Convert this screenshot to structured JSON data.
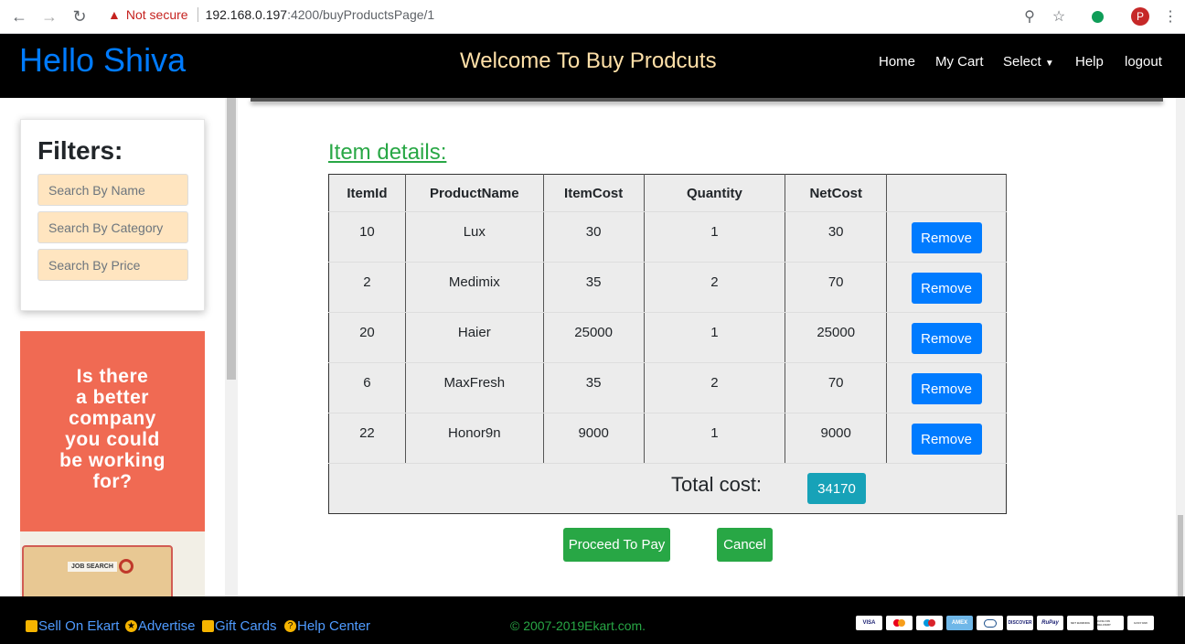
{
  "browser": {
    "security_label": "Not secure",
    "url_host": "192.168.0.197",
    "url_path": ":4200/buyProductsPage/1",
    "profile_initial": "P"
  },
  "header": {
    "greeting": "Hello Shiva",
    "title": "Welcome To Buy Prodcuts",
    "nav": {
      "home": "Home",
      "cart": "My Cart",
      "select": "Select",
      "help": "Help",
      "logout": "logout"
    }
  },
  "sidebar": {
    "filters_title": "Filters:",
    "search_name_placeholder": "Search By Name",
    "search_category_placeholder": "Search By Category",
    "search_price_placeholder": "Search By Price",
    "ad_text": "Is there\na better\ncompany\nyou could\nbe working\nfor?",
    "ad_image_label": "JOB SEARCH"
  },
  "main": {
    "section_title": "Item details:",
    "columns": [
      "ItemId",
      "ProductName",
      "ItemCost",
      "Quantity",
      "NetCost",
      ""
    ],
    "rows": [
      {
        "id": "10",
        "name": "Lux",
        "cost": "30",
        "qty": "1",
        "net": "30"
      },
      {
        "id": "2",
        "name": "Medimix",
        "cost": "35",
        "qty": "2",
        "net": "70"
      },
      {
        "id": "20",
        "name": "Haier",
        "cost": "25000",
        "qty": "1",
        "net": "25000"
      },
      {
        "id": "6",
        "name": "MaxFresh",
        "cost": "35",
        "qty": "2",
        "net": "70"
      },
      {
        "id": "22",
        "name": "Honor9n",
        "cost": "9000",
        "qty": "1",
        "net": "9000"
      }
    ],
    "remove_label": "Remove",
    "total_label": "Total cost:",
    "total_value": "34170",
    "proceed_label": "Proceed To Pay",
    "cancel_label": "Cancel"
  },
  "footer": {
    "sell": "Sell On Ekart",
    "advertise": "Advertise",
    "gift": "Gift Cards",
    "help": "Help Center",
    "copyright": "© 2007-2019Ekart.com.",
    "payments": [
      "VISA",
      "MC",
      "MAESTRO",
      "AMEX",
      "DINERS",
      "DISCOVER",
      "RuPay",
      "NET BANKING",
      "CASH ON DELIVERY",
      "EASY EMI"
    ]
  }
}
